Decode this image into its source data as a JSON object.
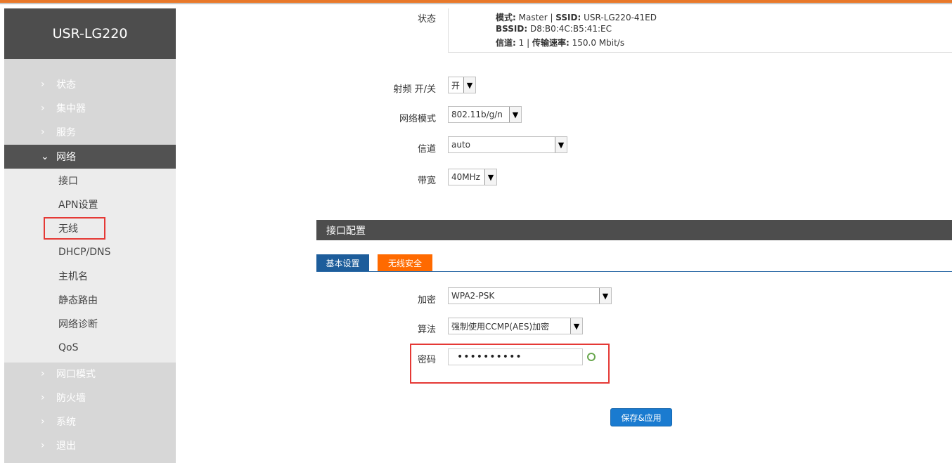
{
  "brand": "USR-LG220",
  "sidebar": {
    "items": [
      {
        "label": "状态"
      },
      {
        "label": "集中器"
      },
      {
        "label": "服务"
      },
      {
        "label": "网络"
      },
      {
        "label": "网口模式"
      },
      {
        "label": "防火墙"
      },
      {
        "label": "系统"
      },
      {
        "label": "退出"
      }
    ],
    "network_sub": [
      {
        "label": "接口"
      },
      {
        "label": "APN设置"
      },
      {
        "label": "无线"
      },
      {
        "label": "DHCP/DNS"
      },
      {
        "label": "主机名"
      },
      {
        "label": "静态路由"
      },
      {
        "label": "网络诊断"
      },
      {
        "label": "QoS"
      }
    ]
  },
  "status": {
    "label": "状态",
    "mode_key": "模式:",
    "mode_val": "Master",
    "ssid_key": "SSID:",
    "ssid_val": "USR-LG220-41ED",
    "bssid_key": "BSSID:",
    "bssid_val": "D8:B0:4C:B5:41:EC",
    "channel_key": "信道:",
    "channel_val": "1",
    "rate_key": "传输速率:",
    "rate_val": "150.0 Mbit/s"
  },
  "device": {
    "radio_label": "射频 开/关",
    "radio_value": "开",
    "mode_label": "网络模式",
    "mode_value": "802.11b/g/n",
    "channel_label": "信道",
    "channel_value": "auto",
    "bandwidth_label": "带宽",
    "bandwidth_value": "40MHz"
  },
  "iface": {
    "title": "接口配置",
    "tab_basic": "基本设置",
    "tab_security": "无线安全",
    "encryption_label": "加密",
    "encryption_value": "WPA2-PSK",
    "cipher_label": "算法",
    "cipher_value": "强制使用CCMP(AES)加密",
    "password_label": "密码",
    "password_value": "••••••••••"
  },
  "save_button": "保存&应用",
  "colors": {
    "accent_orange": "#ff6a00",
    "tab_blue": "#1d5d9b",
    "button_blue": "#1a7bd0",
    "highlight_red": "#e53935"
  }
}
